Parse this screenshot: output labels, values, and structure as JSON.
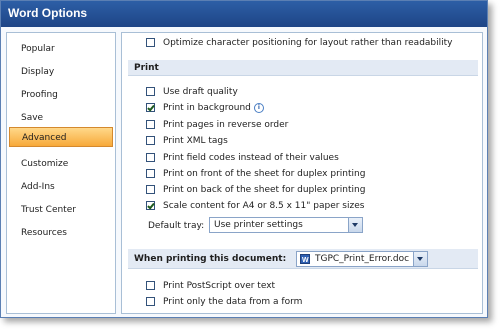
{
  "window": {
    "title": "Word Options"
  },
  "sidebar": {
    "items": [
      {
        "label": "Popular"
      },
      {
        "label": "Display"
      },
      {
        "label": "Proofing"
      },
      {
        "label": "Save"
      },
      {
        "label": "Advanced"
      },
      {
        "label": "Customize"
      },
      {
        "label": "Add-Ins"
      },
      {
        "label": "Trust Center"
      },
      {
        "label": "Resources"
      }
    ],
    "active": "Advanced"
  },
  "content": {
    "top_option": {
      "label": "Optimize character positioning for layout rather than readability",
      "checked": false
    },
    "print_section": {
      "header": "Print",
      "options": [
        {
          "label": "Use draft quality",
          "checked": false
        },
        {
          "label": "Print in background",
          "checked": true
        },
        {
          "label": "Print pages in reverse order",
          "checked": false
        },
        {
          "label": "Print XML tags",
          "checked": false
        },
        {
          "label": "Print field codes instead of their values",
          "checked": false
        },
        {
          "label": "Print on front of the sheet for duplex printing",
          "checked": false
        },
        {
          "label": "Print on back of the sheet for duplex printing",
          "checked": false
        },
        {
          "label": "Scale content for A4 or 8.5 x 11\" paper sizes",
          "checked": true
        }
      ],
      "default_tray_label": "Default tray:",
      "default_tray_value": "Use printer settings"
    },
    "when_printing_section": {
      "header": "When printing this document:",
      "document": "TGPC_Print_Error.doc",
      "options": [
        {
          "label": "Print PostScript over text",
          "checked": false
        },
        {
          "label": "Print only the data from a form",
          "checked": false
        }
      ]
    }
  },
  "icons": {
    "info": "info-icon",
    "document": "word-document-icon",
    "dropdown": "chevron-down-icon"
  },
  "colors": {
    "title_bar": "#1e4586",
    "active_nav": "#f7a93a",
    "section_header": "#e3eaf4"
  }
}
